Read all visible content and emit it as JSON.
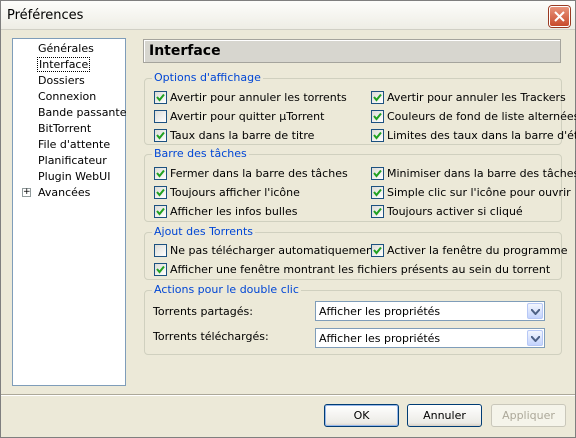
{
  "window": {
    "title": "Préférences"
  },
  "tree": {
    "items": [
      {
        "label": "Générales"
      },
      {
        "label": "Interface",
        "selected": true
      },
      {
        "label": "Dossiers"
      },
      {
        "label": "Connexion"
      },
      {
        "label": "Bande passante"
      },
      {
        "label": "BitTorrent"
      },
      {
        "label": "File d'attente"
      },
      {
        "label": "Planificateur"
      },
      {
        "label": "Plugin WebUI"
      },
      {
        "label": "Avancées",
        "expandable": true,
        "expander": "+"
      }
    ]
  },
  "page": {
    "title": "Interface"
  },
  "display_options": {
    "legend": "Options d'affichage",
    "items": [
      {
        "label": "Avertir pour annuler les torrents",
        "checked": true
      },
      {
        "label": "Avertir pour annuler les Trackers",
        "checked": true
      },
      {
        "label": "Avertir pour quitter µTorrent",
        "checked": false
      },
      {
        "label": "Couleurs de fond de liste alternées",
        "checked": true
      },
      {
        "label": "Taux dans la barre de titre",
        "checked": true
      },
      {
        "label": "Limites des taux dans la barre d'état",
        "checked": true
      }
    ]
  },
  "taskbar": {
    "legend": "Barre des tâches",
    "items": [
      {
        "label": "Fermer dans la barre des tâches",
        "checked": true
      },
      {
        "label": "Minimiser dans la barre des tâches",
        "checked": true
      },
      {
        "label": "Toujours afficher l'icône",
        "checked": true
      },
      {
        "label": "Simple clic sur l'icône pour ouvrir",
        "checked": true
      },
      {
        "label": "Afficher les infos bulles",
        "checked": true
      },
      {
        "label": "Toujours activer si cliqué",
        "checked": true
      }
    ]
  },
  "add_torrents": {
    "legend": "Ajout des Torrents",
    "items": [
      {
        "label": "Ne pas télécharger automatiquement",
        "checked": false
      },
      {
        "label": "Activer la fenêtre du programme",
        "checked": true
      },
      {
        "label": "Afficher une fenêtre montrant les fichiers présents au sein du torrent",
        "checked": true
      }
    ]
  },
  "double_click": {
    "legend": "Actions pour le double clic",
    "shared_label": "Torrents partagés:",
    "shared_value": "Afficher les propriétés",
    "downloaded_label": "Torrents téléchargés:",
    "downloaded_value": "Afficher les propriétés"
  },
  "buttons": {
    "ok": "OK",
    "cancel": "Annuler",
    "apply": "Appliquer"
  },
  "colors": {
    "legend": "#0046d5",
    "background": "#ece9d8",
    "checkmark": "#21a121"
  }
}
